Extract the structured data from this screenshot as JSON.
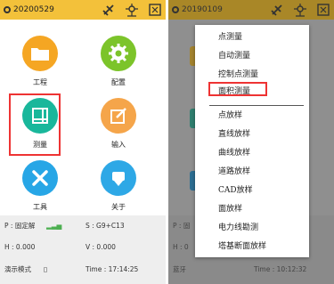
{
  "left": {
    "date": "20200529",
    "apps": [
      {
        "label": "工程",
        "color": "#f5a623"
      },
      {
        "label": "配置",
        "color": "#7cc42a"
      },
      {
        "label": "测量",
        "color": "#19b79b"
      },
      {
        "label": "输入",
        "color": "#f5a54a"
      },
      {
        "label": "工具",
        "color": "#27a6e6"
      },
      {
        "label": "关于",
        "color": "#2ea8e6"
      }
    ],
    "status": {
      "p": "P : 固定解",
      "s": "S : G9+C13",
      "h": "H : 0.000",
      "v": "V : 0.000",
      "mode": "演示模式",
      "time": "Time :  17:14:25"
    }
  },
  "right": {
    "date": "20190109",
    "status": {
      "p": "P : 固",
      "h": "H : 0",
      "mode": "蓝牙",
      "time": "Time :  10:12:32"
    }
  },
  "menu": {
    "items": [
      "点测量",
      "自动测量",
      "控制点测量",
      "面积测量",
      "点放样",
      "直线放样",
      "曲线放样",
      "道路放样",
      "CAD放样",
      "面放样",
      "电力线勘测",
      "塔基断面放样"
    ],
    "selected": "面积测量"
  },
  "colors": {
    "topbar": "#f3c13a",
    "highlight": "#e33333"
  }
}
